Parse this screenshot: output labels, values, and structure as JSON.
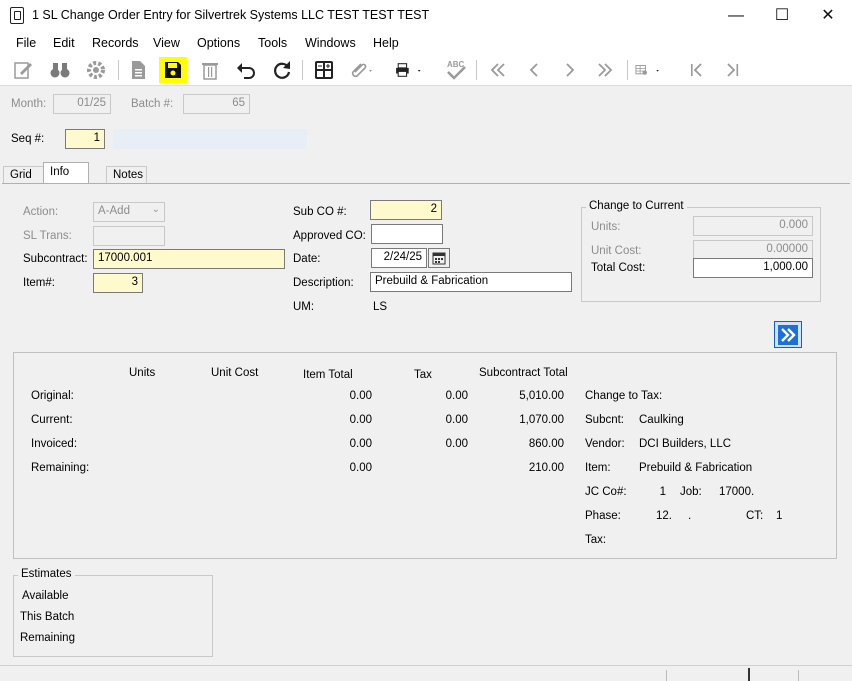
{
  "window": {
    "title": "1 SL Change Order Entry for Silvertrek Systems LLC TEST TEST TEST",
    "minimize_glyph": "—",
    "maximize_glyph": "☐",
    "close_glyph": "✕"
  },
  "menu": [
    "File",
    "Edit",
    "Records",
    "View",
    "Options",
    "Tools",
    "Windows",
    "Help"
  ],
  "toolbar": {
    "icons": [
      "edit-icon",
      "binoculars-icon",
      "gear-icon",
      "document-icon",
      "save-icon",
      "trash-icon",
      "undo-icon",
      "redo-icon",
      "calculator-icon",
      "paperclip-icon",
      "printer-icon",
      "spellcheck-icon",
      "first-record-icon",
      "previous-record-icon",
      "next-record-icon",
      "last-record-icon",
      "grid-settings-icon",
      "first-page-icon",
      "last-page-icon"
    ],
    "highlight_color": "#ffff00"
  },
  "header": {
    "month_label": "Month:",
    "month_value": "01/25",
    "batch_label": "Batch #:",
    "batch_value": "65",
    "seq_label": "Seq #:",
    "seq_value": "1"
  },
  "tabs": [
    "Grid",
    "Info",
    "Notes"
  ],
  "info": {
    "action_label": "Action:",
    "action_value": "A-Add",
    "sl_trans_label": "SL Trans:",
    "sl_trans_value": "",
    "subcontract_label": "Subcontract:",
    "subcontract_value": "17000.001",
    "item_label": "Item#:",
    "item_value": "3",
    "sub_co_label": "Sub CO #:",
    "sub_co_value": "2",
    "approved_co_label": "Approved CO:",
    "approved_co_value": "",
    "date_label": "Date:",
    "date_value": "2/24/25",
    "description_label": "Description:",
    "description_value": "Prebuild & Fabrication",
    "um_label": "UM:",
    "um_value": "LS"
  },
  "change_to_current": {
    "title": "Change to Current",
    "units_label": "Units:",
    "units_value": "0.000",
    "unit_cost_label": "Unit Cost:",
    "unit_cost_value": "0.00000",
    "total_cost_label": "Total Cost:",
    "total_cost_value": "1,000.00"
  },
  "totals": {
    "headers": {
      "units": "Units",
      "unit_cost": "Unit Cost",
      "item_total": "Item Total",
      "tax": "Tax",
      "subcontract_total": "Subcontract Total"
    },
    "rows": [
      {
        "label": "Original:",
        "item_total": "0.00",
        "tax": "0.00",
        "subcontract_total": "5,010.00"
      },
      {
        "label": "Current:",
        "item_total": "0.00",
        "tax": "0.00",
        "subcontract_total": "1,070.00"
      },
      {
        "label": "Invoiced:",
        "item_total": "0.00",
        "tax": "0.00",
        "subcontract_total": "860.00"
      },
      {
        "label": "Remaining:",
        "item_total": "0.00",
        "tax": "",
        "subcontract_total": "210.00"
      }
    ]
  },
  "change_to_tax": {
    "title": "Change to Tax:",
    "subcnt_label": "Subcnt:",
    "subcnt_value": "Caulking",
    "vendor_label": "Vendor:",
    "vendor_value": "DCI Builders, LLC",
    "item_label": "Item:",
    "item_value": "Prebuild & Fabrication",
    "jcco_label": "JC Co#:",
    "jcco_value": "1",
    "job_label": "Job:",
    "job_value": "17000.",
    "phase_label": "Phase:",
    "phase_value": "12.     .",
    "ct_label": "CT:",
    "ct_value": "1",
    "tax_label": "Tax:",
    "tax_value": ""
  },
  "estimates": {
    "title": "Estimates",
    "available": "Available",
    "this_batch": "This Batch",
    "remaining": "Remaining"
  }
}
